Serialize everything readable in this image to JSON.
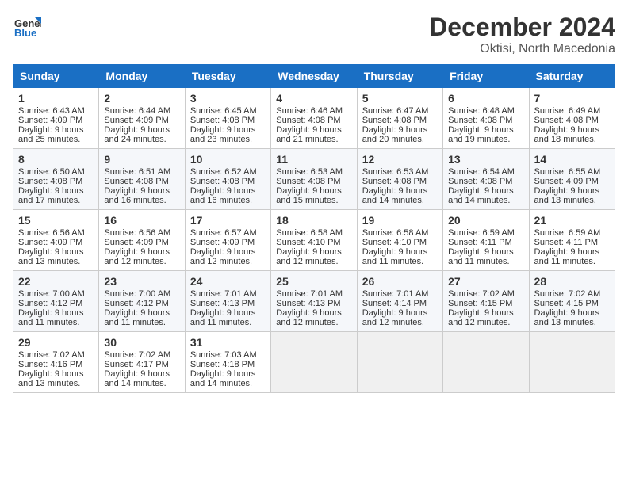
{
  "header": {
    "logo_line1": "General",
    "logo_line2": "Blue",
    "month": "December 2024",
    "location": "Oktisi, North Macedonia"
  },
  "weekdays": [
    "Sunday",
    "Monday",
    "Tuesday",
    "Wednesday",
    "Thursday",
    "Friday",
    "Saturday"
  ],
  "weeks": [
    [
      {
        "day": "1",
        "lines": [
          "Sunrise: 6:43 AM",
          "Sunset: 4:09 PM",
          "Daylight: 9 hours",
          "and 25 minutes."
        ]
      },
      {
        "day": "2",
        "lines": [
          "Sunrise: 6:44 AM",
          "Sunset: 4:09 PM",
          "Daylight: 9 hours",
          "and 24 minutes."
        ]
      },
      {
        "day": "3",
        "lines": [
          "Sunrise: 6:45 AM",
          "Sunset: 4:08 PM",
          "Daylight: 9 hours",
          "and 23 minutes."
        ]
      },
      {
        "day": "4",
        "lines": [
          "Sunrise: 6:46 AM",
          "Sunset: 4:08 PM",
          "Daylight: 9 hours",
          "and 21 minutes."
        ]
      },
      {
        "day": "5",
        "lines": [
          "Sunrise: 6:47 AM",
          "Sunset: 4:08 PM",
          "Daylight: 9 hours",
          "and 20 minutes."
        ]
      },
      {
        "day": "6",
        "lines": [
          "Sunrise: 6:48 AM",
          "Sunset: 4:08 PM",
          "Daylight: 9 hours",
          "and 19 minutes."
        ]
      },
      {
        "day": "7",
        "lines": [
          "Sunrise: 6:49 AM",
          "Sunset: 4:08 PM",
          "Daylight: 9 hours",
          "and 18 minutes."
        ]
      }
    ],
    [
      {
        "day": "8",
        "lines": [
          "Sunrise: 6:50 AM",
          "Sunset: 4:08 PM",
          "Daylight: 9 hours",
          "and 17 minutes."
        ]
      },
      {
        "day": "9",
        "lines": [
          "Sunrise: 6:51 AM",
          "Sunset: 4:08 PM",
          "Daylight: 9 hours",
          "and 16 minutes."
        ]
      },
      {
        "day": "10",
        "lines": [
          "Sunrise: 6:52 AM",
          "Sunset: 4:08 PM",
          "Daylight: 9 hours",
          "and 16 minutes."
        ]
      },
      {
        "day": "11",
        "lines": [
          "Sunrise: 6:53 AM",
          "Sunset: 4:08 PM",
          "Daylight: 9 hours",
          "and 15 minutes."
        ]
      },
      {
        "day": "12",
        "lines": [
          "Sunrise: 6:53 AM",
          "Sunset: 4:08 PM",
          "Daylight: 9 hours",
          "and 14 minutes."
        ]
      },
      {
        "day": "13",
        "lines": [
          "Sunrise: 6:54 AM",
          "Sunset: 4:08 PM",
          "Daylight: 9 hours",
          "and 14 minutes."
        ]
      },
      {
        "day": "14",
        "lines": [
          "Sunrise: 6:55 AM",
          "Sunset: 4:09 PM",
          "Daylight: 9 hours",
          "and 13 minutes."
        ]
      }
    ],
    [
      {
        "day": "15",
        "lines": [
          "Sunrise: 6:56 AM",
          "Sunset: 4:09 PM",
          "Daylight: 9 hours",
          "and 13 minutes."
        ]
      },
      {
        "day": "16",
        "lines": [
          "Sunrise: 6:56 AM",
          "Sunset: 4:09 PM",
          "Daylight: 9 hours",
          "and 12 minutes."
        ]
      },
      {
        "day": "17",
        "lines": [
          "Sunrise: 6:57 AM",
          "Sunset: 4:09 PM",
          "Daylight: 9 hours",
          "and 12 minutes."
        ]
      },
      {
        "day": "18",
        "lines": [
          "Sunrise: 6:58 AM",
          "Sunset: 4:10 PM",
          "Daylight: 9 hours",
          "and 12 minutes."
        ]
      },
      {
        "day": "19",
        "lines": [
          "Sunrise: 6:58 AM",
          "Sunset: 4:10 PM",
          "Daylight: 9 hours",
          "and 11 minutes."
        ]
      },
      {
        "day": "20",
        "lines": [
          "Sunrise: 6:59 AM",
          "Sunset: 4:11 PM",
          "Daylight: 9 hours",
          "and 11 minutes."
        ]
      },
      {
        "day": "21",
        "lines": [
          "Sunrise: 6:59 AM",
          "Sunset: 4:11 PM",
          "Daylight: 9 hours",
          "and 11 minutes."
        ]
      }
    ],
    [
      {
        "day": "22",
        "lines": [
          "Sunrise: 7:00 AM",
          "Sunset: 4:12 PM",
          "Daylight: 9 hours",
          "and 11 minutes."
        ]
      },
      {
        "day": "23",
        "lines": [
          "Sunrise: 7:00 AM",
          "Sunset: 4:12 PM",
          "Daylight: 9 hours",
          "and 11 minutes."
        ]
      },
      {
        "day": "24",
        "lines": [
          "Sunrise: 7:01 AM",
          "Sunset: 4:13 PM",
          "Daylight: 9 hours",
          "and 11 minutes."
        ]
      },
      {
        "day": "25",
        "lines": [
          "Sunrise: 7:01 AM",
          "Sunset: 4:13 PM",
          "Daylight: 9 hours",
          "and 12 minutes."
        ]
      },
      {
        "day": "26",
        "lines": [
          "Sunrise: 7:01 AM",
          "Sunset: 4:14 PM",
          "Daylight: 9 hours",
          "and 12 minutes."
        ]
      },
      {
        "day": "27",
        "lines": [
          "Sunrise: 7:02 AM",
          "Sunset: 4:15 PM",
          "Daylight: 9 hours",
          "and 12 minutes."
        ]
      },
      {
        "day": "28",
        "lines": [
          "Sunrise: 7:02 AM",
          "Sunset: 4:15 PM",
          "Daylight: 9 hours",
          "and 13 minutes."
        ]
      }
    ],
    [
      {
        "day": "29",
        "lines": [
          "Sunrise: 7:02 AM",
          "Sunset: 4:16 PM",
          "Daylight: 9 hours",
          "and 13 minutes."
        ]
      },
      {
        "day": "30",
        "lines": [
          "Sunrise: 7:02 AM",
          "Sunset: 4:17 PM",
          "Daylight: 9 hours",
          "and 14 minutes."
        ]
      },
      {
        "day": "31",
        "lines": [
          "Sunrise: 7:03 AM",
          "Sunset: 4:18 PM",
          "Daylight: 9 hours",
          "and 14 minutes."
        ]
      },
      null,
      null,
      null,
      null
    ]
  ]
}
